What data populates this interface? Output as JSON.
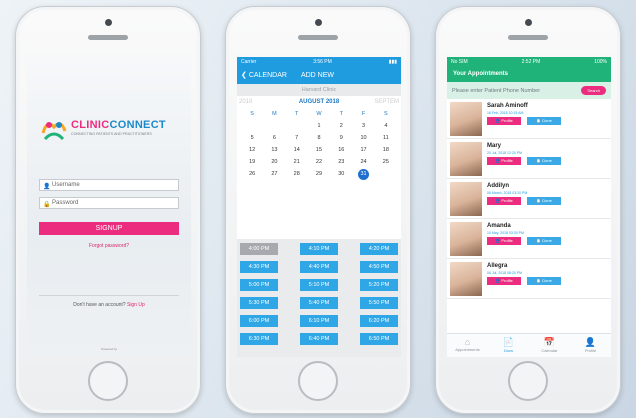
{
  "login": {
    "brand_a": "CLINIC",
    "brand_b": "CONNECT",
    "tagline": "CONNECTING PATIENTS AND PRACTITIONERS",
    "username_placeholder": "Username",
    "password_placeholder": "Password",
    "signup_label": "SIGNUP",
    "forgot_label": "Forgot password?",
    "no_account_text": "Don't have an account?",
    "signup_link": "Sign Up",
    "powered_by": "Powered by"
  },
  "calendar": {
    "status_carrier": "Carrier",
    "status_time": "3:56 PM",
    "back_label": "CALENDAR",
    "title": "ADD NEW",
    "clinic_name": "Harvard Clinic",
    "prev_month": "2018",
    "month": "AUGUST 2018",
    "next_month": "SEPTEM",
    "weekdays": [
      "S",
      "M",
      "T",
      "W",
      "T",
      "F",
      "S"
    ],
    "days": [
      "",
      "",
      "",
      "1",
      "2",
      "3",
      "4",
      "5",
      "6",
      "7",
      "8",
      "9",
      "10",
      "11",
      "12",
      "13",
      "14",
      "15",
      "16",
      "17",
      "18",
      "19",
      "20",
      "21",
      "22",
      "23",
      "24",
      "25",
      "26",
      "27",
      "28",
      "29",
      "30",
      "31",
      ""
    ],
    "selected_day": "31",
    "slots": [
      [
        "4:00 PM",
        "4:10 PM",
        "4:20 PM"
      ],
      [
        "4:30 PM",
        "4:40 PM",
        "4:50 PM"
      ],
      [
        "5:00 PM",
        "5:10 PM",
        "5:20 PM"
      ],
      [
        "5:30 PM",
        "5:40 PM",
        "5:50 PM"
      ],
      [
        "6:00 PM",
        "6:10 PM",
        "6:20 PM"
      ],
      [
        "6:30 PM",
        "6:40 PM",
        "6:50 PM"
      ]
    ]
  },
  "appointments": {
    "status_carrier": "No SIM",
    "status_time": "2:52 PM",
    "status_battery": "100%",
    "title": "Your Appointments",
    "search_placeholder": "Please enter Patient Phone Number",
    "search_label": "Search",
    "profile_label": "Profile",
    "done_label": "Done",
    "patients": [
      {
        "name": "Sarah Aminoff",
        "date": "16 Feb, 2018  10:15 AM"
      },
      {
        "name": "Mary",
        "date": "20 Jul, 2018  12:20 PM"
      },
      {
        "name": "Addilyn",
        "date": "06 March, 2018  03:20 PM"
      },
      {
        "name": "Amanda",
        "date": "10 May, 2018  03:30 PM"
      },
      {
        "name": "Allegra",
        "date": "06 Jul, 2018  08:20 PM"
      }
    ],
    "tabs": [
      "Appointments",
      "Docs",
      "Calendar",
      "Profile"
    ]
  },
  "colors": {
    "accent_pink": "#ec2c7f",
    "blue": "#1f9be0",
    "green": "#1fb37a"
  }
}
